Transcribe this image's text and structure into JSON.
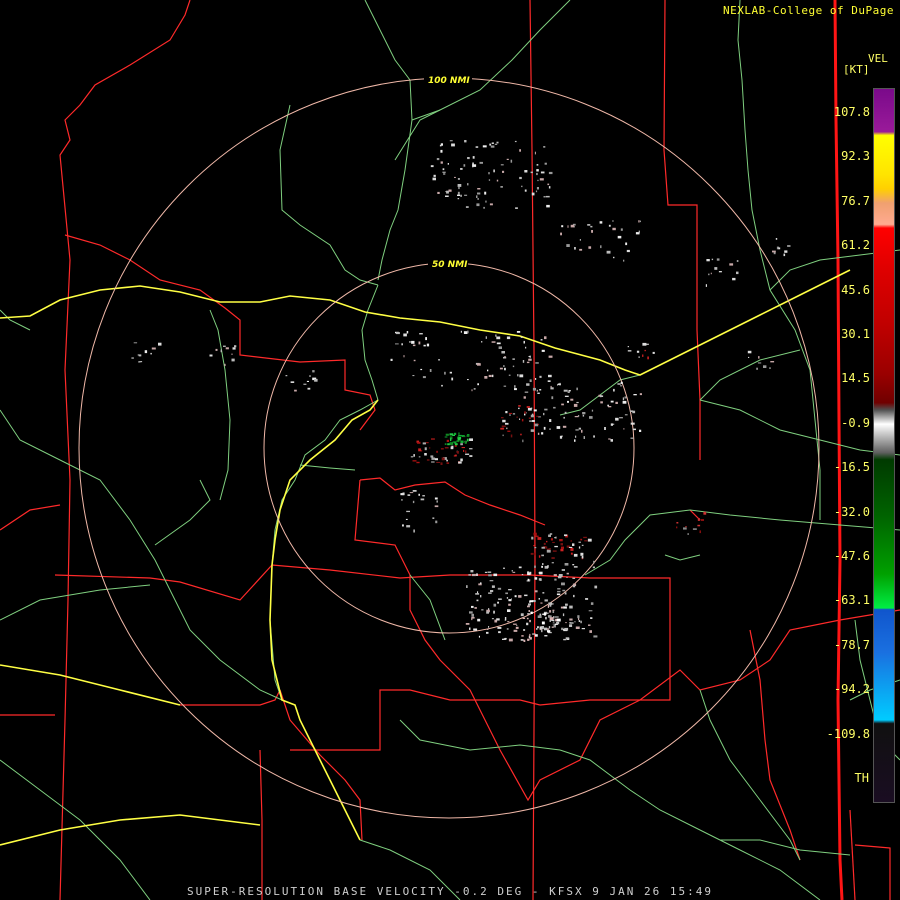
{
  "header": {
    "credit": "NEXLAB-College of DuPage"
  },
  "footer": {
    "product_line": "SUPER-RESOLUTION BASE VELOCITY -0.2 DEG - KFSX 9 JAN 26 15:49"
  },
  "range_rings": [
    {
      "label": "100 NMI"
    },
    {
      "label": "50 NMI"
    }
  ],
  "legend": {
    "product": "VEL",
    "unit": "[KT]",
    "labels": [
      "107.8",
      "92.3",
      "76.7",
      "61.2",
      "45.6",
      "30.1",
      "14.5",
      "-0.9",
      "-16.5",
      "-32.0",
      "-47.6",
      "-63.1",
      "-78.7",
      "-94.2",
      "-109.8"
    ],
    "threshold_label": "TH"
  },
  "colors": {
    "state_boundary": "#ff2020",
    "county_boundary": "#ff2020",
    "highway": "#ffff44",
    "road": "#77cc77",
    "range_ring": "#f0b8a8",
    "inbound": "#11aa33",
    "outbound": "#aa1111"
  }
}
